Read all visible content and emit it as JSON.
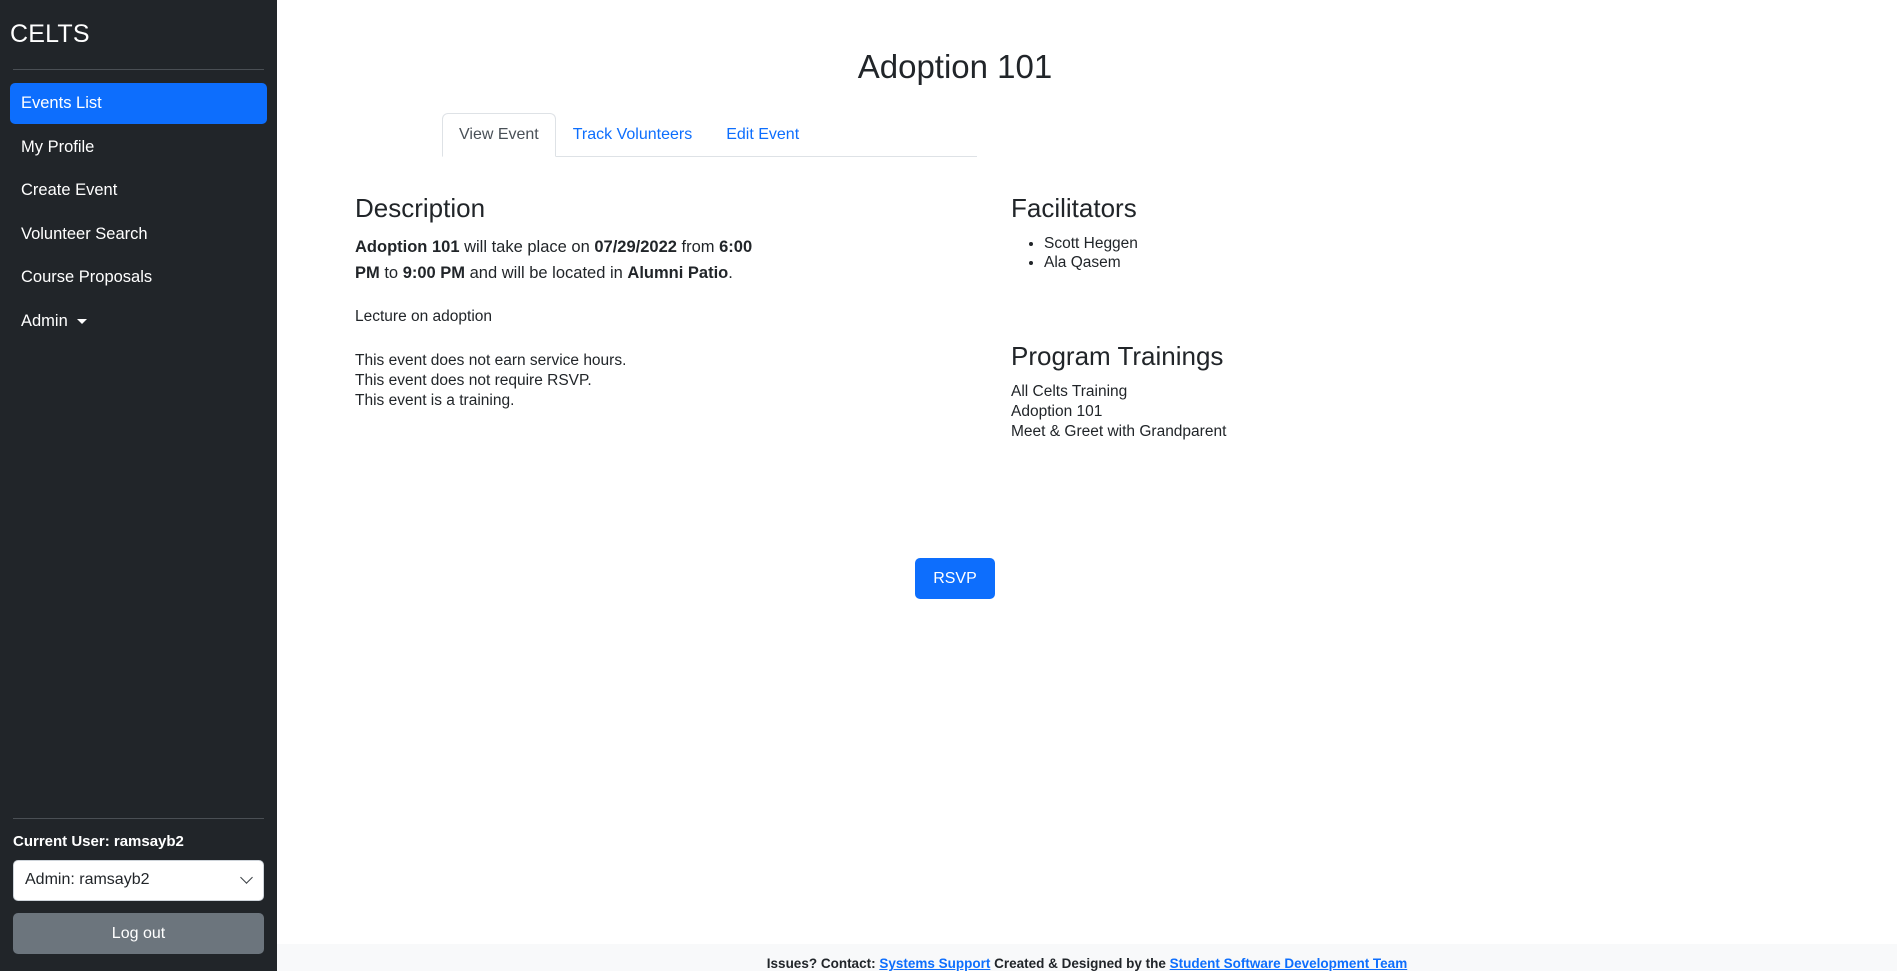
{
  "sidebar": {
    "brand": "CELTS",
    "nav_items": [
      {
        "label": "Events List",
        "active": true
      },
      {
        "label": "My Profile",
        "active": false
      },
      {
        "label": "Create Event",
        "active": false
      },
      {
        "label": "Volunteer Search",
        "active": false
      },
      {
        "label": "Course Proposals",
        "active": false
      },
      {
        "label": "Admin",
        "active": false,
        "dropdown": true
      }
    ],
    "current_user_label": "Current User: ramsayb2",
    "user_select": {
      "selected": "Admin: ramsayb2",
      "options": [
        "Admin: ramsayb2"
      ]
    },
    "logout_label": "Log out"
  },
  "main": {
    "title": "Adoption 101",
    "tabs": [
      {
        "label": "View Event",
        "active": true
      },
      {
        "label": "Track Volunteers",
        "active": false
      },
      {
        "label": "Edit Event",
        "active": false
      }
    ],
    "description": {
      "heading": "Description",
      "summary_parts": {
        "event_name": "Adoption 101",
        "text_1": " will take place on ",
        "date": "07/29/2022",
        "text_2": " from ",
        "start_time": "6:00 PM",
        "text_3": " to ",
        "end_time": "9:00 PM",
        "text_4": " and will be located in ",
        "location": "Alumni Patio",
        "text_5": "."
      },
      "note": "Lecture on adoption",
      "flags": [
        "This event does not earn service hours.",
        "This event does not require RSVP.",
        "This event is a training."
      ]
    },
    "facilitators": {
      "heading": "Facilitators",
      "items": [
        "Scott Heggen",
        "Ala Qasem"
      ]
    },
    "program_trainings": {
      "heading": "Program Trainings",
      "items": [
        "All Celts Training",
        "Adoption 101",
        "Meet & Greet with Grandparent"
      ]
    },
    "rsvp_label": "RSVP"
  },
  "footer": {
    "prefix": "Issues? Contact: ",
    "support_link": "Systems Support",
    "middle": " Created & Designed by the ",
    "team_link": "Student Software Development Team"
  },
  "colors": {
    "sidebar_bg": "#212529",
    "accent": "#0d6efd",
    "logout_gray": "#6c757d",
    "footer_bg": "#f8f9fa",
    "text": "#212529"
  }
}
